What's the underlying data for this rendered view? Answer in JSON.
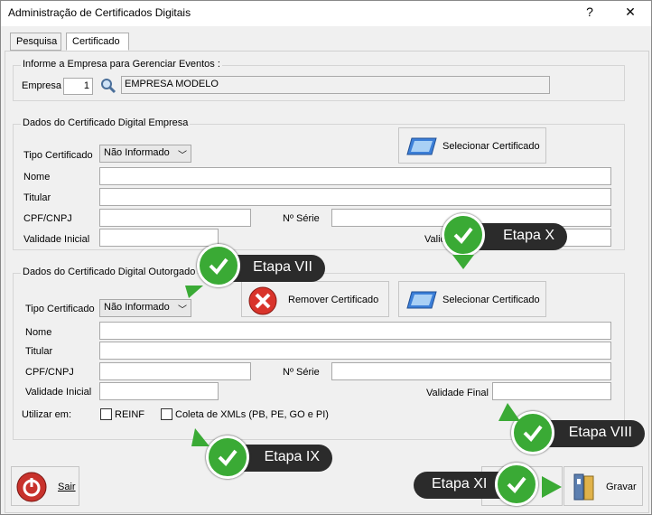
{
  "window": {
    "title": "Administração de Certificados Digitais",
    "help_label": "?",
    "close_label": "✕"
  },
  "tabs": [
    {
      "label": "Pesquisa"
    },
    {
      "label": "Certificado"
    }
  ],
  "empresa_group": {
    "title": "Informe a Empresa para Gerenciar Eventos :",
    "empresa_label": "Empresa",
    "empresa_value": "1",
    "empresa_name": "EMPRESA MODELO"
  },
  "empresa_cert": {
    "title": "Dados do Certificado Digital Empresa",
    "tipo_label": "Tipo Certificado",
    "tipo_value": "Não Informado",
    "select_button": "Selecionar Certificado",
    "nome_label": "Nome",
    "nome_value": "",
    "titular_label": "Titular",
    "titular_value": "",
    "cpf_label": "CPF/CNPJ",
    "cpf_value": "",
    "serie_label": "Nº Série",
    "serie_value": "",
    "validade_inicial_label": "Validade Inicial",
    "validade_inicial_value": "",
    "validade_final_label": "Valid",
    "validade_final_value": ""
  },
  "outorgado_cert": {
    "title": "Dados do Certificado Digital Outorgado",
    "tipo_label": "Tipo Certificado",
    "tipo_value": "Não Informado",
    "remove_button": "Remover Certificado",
    "select_button": "Selecionar Certificado",
    "nome_label": "Nome",
    "nome_value": "",
    "titular_label": "Titular",
    "titular_value": "",
    "cpf_label": "CPF/CNPJ",
    "cpf_value": "",
    "serie_label": "Nº Série",
    "serie_value": "",
    "validade_inicial_label": "Validade Inicial",
    "validade_inicial_value": "",
    "validade_final_label": "Validade Final",
    "validade_final_value": "",
    "utilizar_label": "Utilizar em:",
    "reinf_label": "REINF",
    "reinf_checked": false,
    "coleta_label": "Coleta de XMLs (PB, PE, GO e PI)",
    "coleta_checked": false
  },
  "footer": {
    "sair_label": "Sair",
    "gravar_label": "Gravar"
  },
  "annotations": [
    {
      "label": "Etapa VII"
    },
    {
      "label": "Etapa X"
    },
    {
      "label": "Etapa VIII"
    },
    {
      "label": "Etapa IX"
    },
    {
      "label": "Etapa XI"
    }
  ],
  "colors": {
    "annotation_green": "#3aaa35",
    "annotation_dark": "#2b2b2b",
    "remove_red": "#d9342b",
    "cert_blue": "#3c7fd8"
  }
}
